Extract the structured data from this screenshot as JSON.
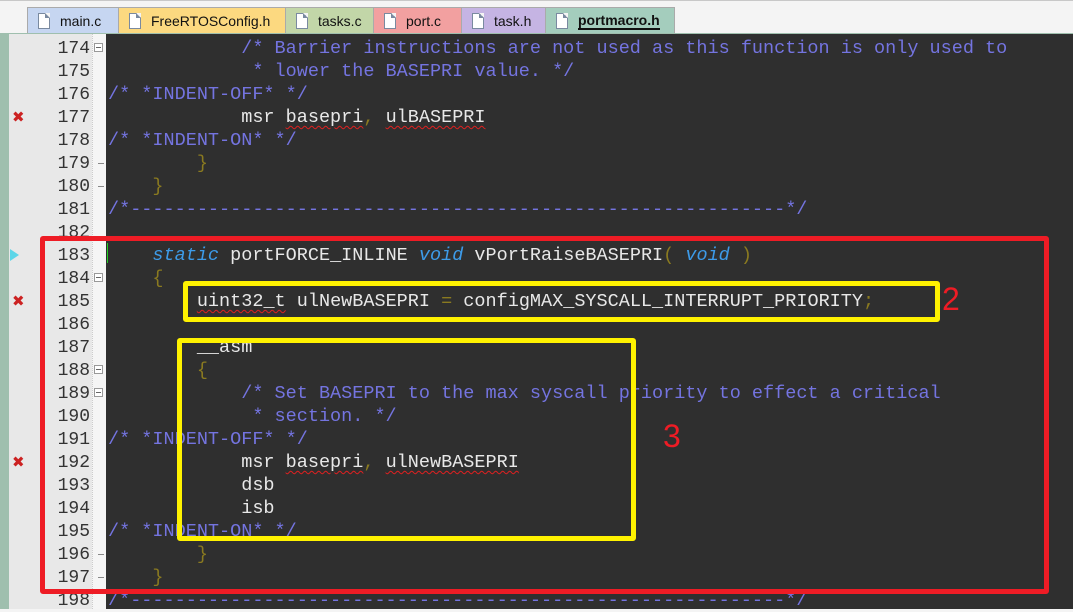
{
  "tabs": [
    {
      "label": "main.c",
      "color": "#c6d6f1",
      "active": false
    },
    {
      "label": "FreeRTOSConfig.h",
      "color": "#fcd980",
      "active": false
    },
    {
      "label": "tasks.c",
      "color": "#c2d6a8",
      "active": false
    },
    {
      "label": "port.c",
      "color": "#f2a0a0",
      "active": false
    },
    {
      "label": "task.h",
      "color": "#c5b4e3",
      "active": false
    },
    {
      "label": "portmacro.h",
      "color": "#a4cdbd",
      "active": true
    }
  ],
  "lines": [
    {
      "n": "174",
      "marker": "",
      "fold": "open",
      "segs": [
        {
          "t": "            ",
          "c": ""
        },
        {
          "t": "/* Barrier instructions are not used as this function is only used to",
          "c": "cm"
        }
      ]
    },
    {
      "n": "175",
      "marker": "",
      "fold": "",
      "segs": [
        {
          "t": "             ",
          "c": ""
        },
        {
          "t": "* lower the BASEPRI value. */",
          "c": "cm"
        }
      ]
    },
    {
      "n": "176",
      "marker": "",
      "fold": "",
      "segs": [
        {
          "t": "/* *INDENT-OFF* */",
          "c": "cm"
        }
      ]
    },
    {
      "n": "177",
      "marker": "error",
      "fold": "",
      "segs": [
        {
          "t": "            msr ",
          "c": ""
        },
        {
          "t": "basepri",
          "c": "sq"
        },
        {
          "t": ",",
          "c": "br"
        },
        {
          "t": " ",
          "c": ""
        },
        {
          "t": "ulBASEPRI",
          "c": "sq"
        }
      ]
    },
    {
      "n": "178",
      "marker": "",
      "fold": "",
      "segs": [
        {
          "t": "/* *INDENT-ON* */",
          "c": "cm"
        }
      ]
    },
    {
      "n": "179",
      "marker": "",
      "fold": "end",
      "segs": [
        {
          "t": "        ",
          "c": ""
        },
        {
          "t": "}",
          "c": "br"
        }
      ]
    },
    {
      "n": "180",
      "marker": "",
      "fold": "end",
      "segs": [
        {
          "t": "    ",
          "c": ""
        },
        {
          "t": "}",
          "c": "br"
        }
      ]
    },
    {
      "n": "181",
      "marker": "",
      "fold": "",
      "segs": [
        {
          "t": "/*-----------------------------------------------------------*/",
          "c": "cm"
        }
      ]
    },
    {
      "n": "182",
      "marker": "",
      "fold": "",
      "segs": []
    },
    {
      "n": "183",
      "marker": "bookmark",
      "fold": "",
      "segs": [
        {
          "t": "    ",
          "c": ""
        },
        {
          "t": "static",
          "c": "kw"
        },
        {
          "t": " portFORCE_INLINE ",
          "c": ""
        },
        {
          "t": "void",
          "c": "kw"
        },
        {
          "t": " vPortRaiseBASEPRI",
          "c": ""
        },
        {
          "t": "( ",
          "c": "br"
        },
        {
          "t": "void",
          "c": "kw"
        },
        {
          "t": " )",
          "c": "br"
        }
      ]
    },
    {
      "n": "184",
      "marker": "",
      "fold": "open",
      "segs": [
        {
          "t": "    ",
          "c": ""
        },
        {
          "t": "{",
          "c": "br"
        }
      ]
    },
    {
      "n": "185",
      "marker": "error",
      "fold": "",
      "segs": [
        {
          "t": "        ",
          "c": ""
        },
        {
          "t": "uint32_t",
          "c": "sq"
        },
        {
          "t": " ulNewBASEPRI ",
          "c": ""
        },
        {
          "t": "=",
          "c": "br"
        },
        {
          "t": " configMAX_SYSCALL_INTERRUPT_PRIORITY",
          "c": ""
        },
        {
          "t": ";",
          "c": "br"
        }
      ]
    },
    {
      "n": "186",
      "marker": "",
      "fold": "",
      "segs": []
    },
    {
      "n": "187",
      "marker": "",
      "fold": "",
      "segs": [
        {
          "t": "        __asm",
          "c": ""
        }
      ]
    },
    {
      "n": "188",
      "marker": "",
      "fold": "open",
      "segs": [
        {
          "t": "        ",
          "c": ""
        },
        {
          "t": "{",
          "c": "br"
        }
      ]
    },
    {
      "n": "189",
      "marker": "",
      "fold": "open",
      "segs": [
        {
          "t": "            ",
          "c": ""
        },
        {
          "t": "/* Set BASEPRI to the max syscall priority to effect a critical",
          "c": "cm"
        }
      ]
    },
    {
      "n": "190",
      "marker": "",
      "fold": "",
      "segs": [
        {
          "t": "             ",
          "c": ""
        },
        {
          "t": "* section. */",
          "c": "cm"
        }
      ]
    },
    {
      "n": "191",
      "marker": "",
      "fold": "",
      "segs": [
        {
          "t": "/* *INDENT-OFF* */",
          "c": "cm"
        }
      ]
    },
    {
      "n": "192",
      "marker": "error",
      "fold": "",
      "segs": [
        {
          "t": "            msr ",
          "c": ""
        },
        {
          "t": "basepri",
          "c": "sq"
        },
        {
          "t": ",",
          "c": "br"
        },
        {
          "t": " ",
          "c": ""
        },
        {
          "t": "ulNewBASEPRI",
          "c": "sq"
        }
      ]
    },
    {
      "n": "193",
      "marker": "",
      "fold": "",
      "segs": [
        {
          "t": "            dsb",
          "c": ""
        }
      ]
    },
    {
      "n": "194",
      "marker": "",
      "fold": "",
      "segs": [
        {
          "t": "            isb",
          "c": ""
        }
      ]
    },
    {
      "n": "195",
      "marker": "",
      "fold": "",
      "segs": [
        {
          "t": "/* *INDENT-ON* */",
          "c": "cm"
        }
      ]
    },
    {
      "n": "196",
      "marker": "",
      "fold": "end",
      "segs": [
        {
          "t": "        ",
          "c": ""
        },
        {
          "t": "}",
          "c": "br"
        }
      ]
    },
    {
      "n": "197",
      "marker": "",
      "fold": "end",
      "segs": [
        {
          "t": "    ",
          "c": ""
        },
        {
          "t": "}",
          "c": "br"
        }
      ]
    },
    {
      "n": "198",
      "marker": "",
      "fold": "",
      "segs": [
        {
          "t": "/*-----------------------------------------------------------*/",
          "c": "cm"
        }
      ]
    }
  ],
  "annotations": {
    "label_2": "2",
    "label_3": "3",
    "red_box_color": "#ee1c25",
    "yellow_box_color": "#fff200"
  },
  "markers": {
    "error_glyph": "✖"
  }
}
